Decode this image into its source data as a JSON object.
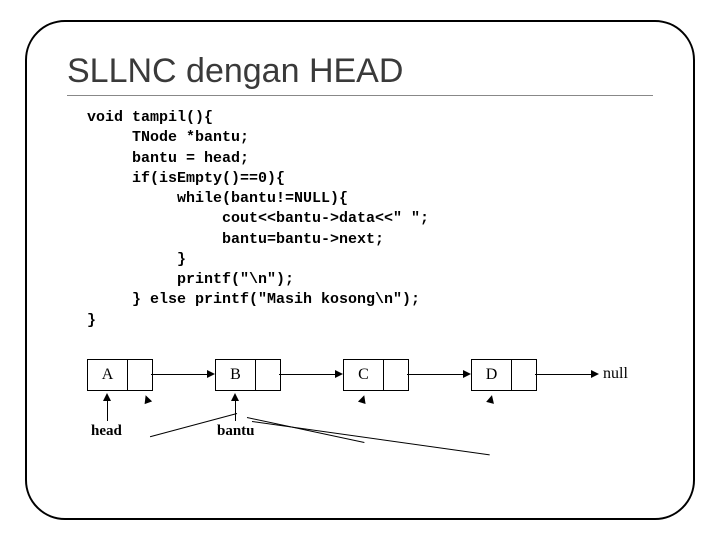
{
  "title": "SLLNC dengan HEAD",
  "code_lines": [
    "void tampil(){",
    "     TNode *bantu;",
    "     bantu = head;",
    "     if(isEmpty()==0){",
    "          while(bantu!=NULL){",
    "               cout<<bantu->data<<\" \";",
    "               bantu=bantu->next;",
    "          }",
    "          printf(\"\\n\");",
    "     } else printf(\"Masih kosong\\n\");",
    "}"
  ],
  "diagram": {
    "nodes": [
      "A",
      "B",
      "C",
      "D"
    ],
    "null_label": "null",
    "head_label": "head",
    "bantu_label": "bantu"
  },
  "page_number": ""
}
